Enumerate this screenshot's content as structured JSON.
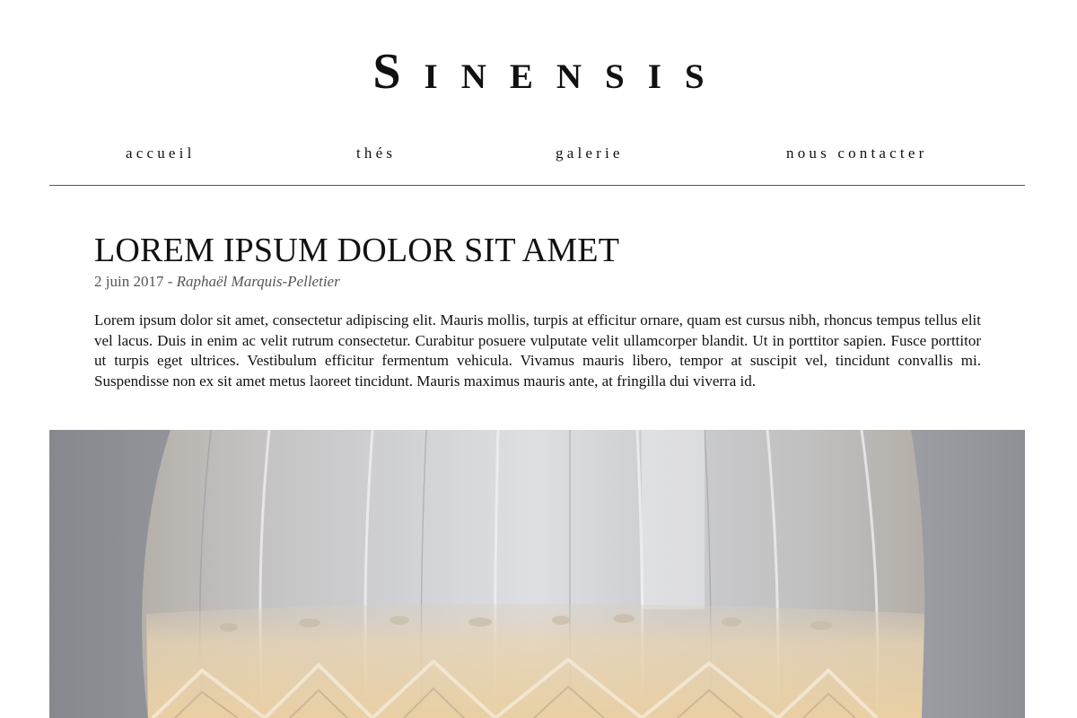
{
  "site": {
    "title": "Sinensis"
  },
  "nav": {
    "items": [
      {
        "label": "accueil"
      },
      {
        "label": "thés"
      },
      {
        "label": "galerie"
      },
      {
        "label": "nous contacter"
      }
    ]
  },
  "article": {
    "title": "LOREM IPSUM DOLOR SIT AMET",
    "date": "2 juin 2017",
    "separator": " - ",
    "author": "Raphaël Marquis-Pelletier",
    "body": "Lorem ipsum dolor sit amet, consectetur adipiscing elit. Mauris mollis, turpis at efficitur ornare, quam est cursus nibh, rhoncus tempus tellus elit vel lacus. Duis in enim ac velit rutrum consectetur. Curabitur posuere vulputate velit ullamcorper blandit. Ut in porttitor sapien. Fusce porttitor ut turpis eget ultrices. Vestibulum efficitur fermentum vehicula. Vivamus mauris libero, tempor at suscipit vel, tincidunt convallis mi. Suspendisse non ex sit amet metus laoreet tincidunt. Mauris maximus mauris ante, at fringilla dui viverra id."
  },
  "photo": {
    "subject": "crystal-glass-of-tea",
    "colors": {
      "background": "#a5a7ad",
      "liquid": "#e6cfa8",
      "glass": "#d8dade"
    }
  }
}
